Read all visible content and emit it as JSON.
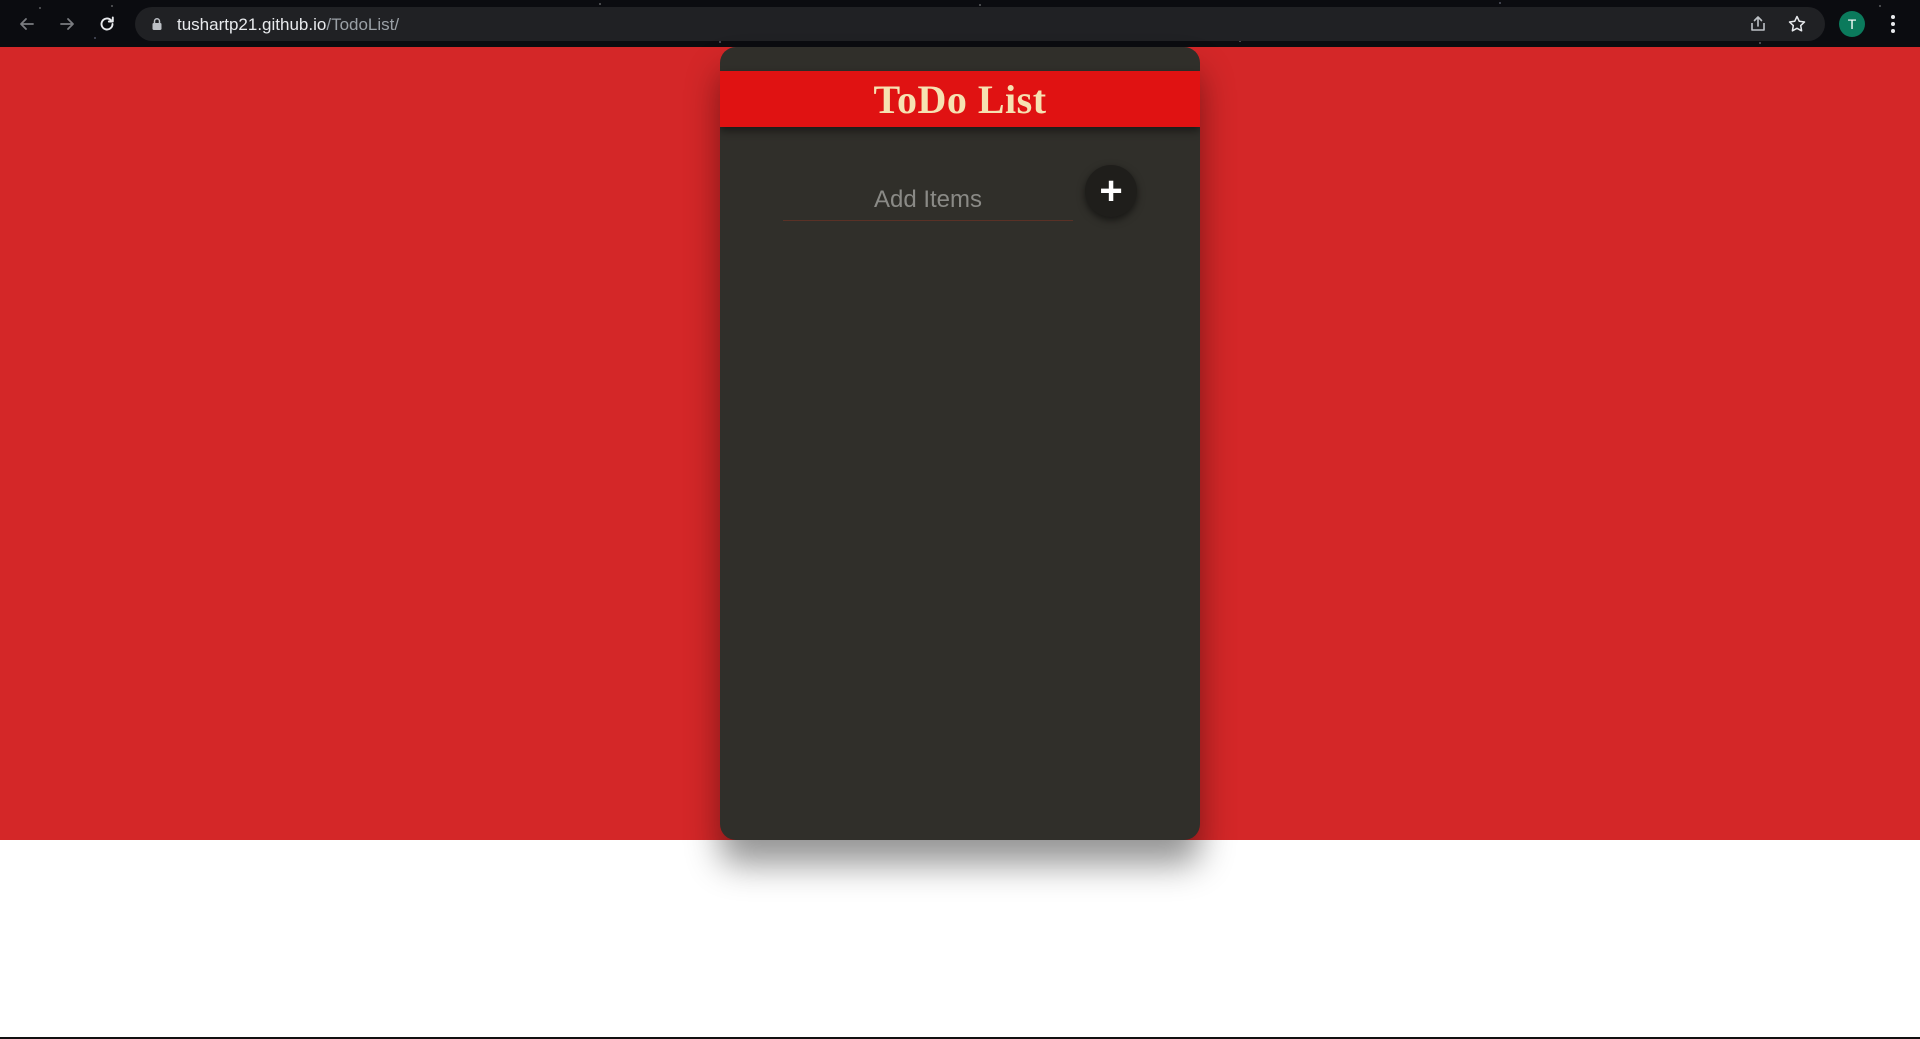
{
  "browser": {
    "url_host": "tushartp21.github.io",
    "url_path": "/TodoList/",
    "profile_initial": "T",
    "icons": {
      "back": "arrow-left-icon",
      "forward": "arrow-right-icon",
      "reload": "reload-icon",
      "lock": "lock-icon",
      "share": "share-icon",
      "bookmark": "star-icon",
      "menu": "kebab-menu-icon"
    }
  },
  "app": {
    "title": "ToDo List",
    "input_placeholder": "Add Items",
    "input_value": "",
    "add_button_label": "+",
    "items": []
  },
  "colors": {
    "page_background": "#d42728",
    "card_background": "#302f2a",
    "header_background": "#e01212",
    "title_color": "#f6e2b2",
    "add_button_background": "#1f1e1b"
  }
}
